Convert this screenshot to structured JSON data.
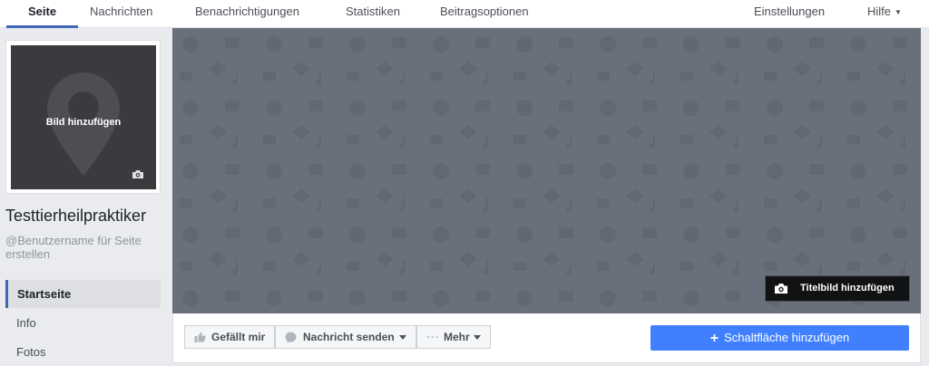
{
  "topnav": {
    "tabs": [
      {
        "label": "Seite"
      },
      {
        "label": "Nachrichten"
      },
      {
        "label": "Benachrichtigungen"
      },
      {
        "label": "Statistiken"
      },
      {
        "label": "Beitragsoptionen"
      }
    ],
    "settings": "Einstellungen",
    "help": "Hilfe"
  },
  "profile": {
    "add_photo": "Bild hinzufügen",
    "page_name": "Testtierheilpraktiker",
    "username_prompt": "@Benutzername für Seite erstellen"
  },
  "sidebar": {
    "items": [
      {
        "label": "Startseite"
      },
      {
        "label": "Info"
      },
      {
        "label": "Fotos"
      }
    ]
  },
  "cover": {
    "add_cover": "Titelbild hinzufügen"
  },
  "actions": {
    "like": "Gefällt mir",
    "message": "Nachricht senden",
    "more": "Mehr",
    "add_button": "Schaltfläche hinzufügen"
  },
  "colors": {
    "accent": "#4267b2",
    "primary_button": "#4080ff",
    "cover_bg": "#6a6f7c"
  }
}
